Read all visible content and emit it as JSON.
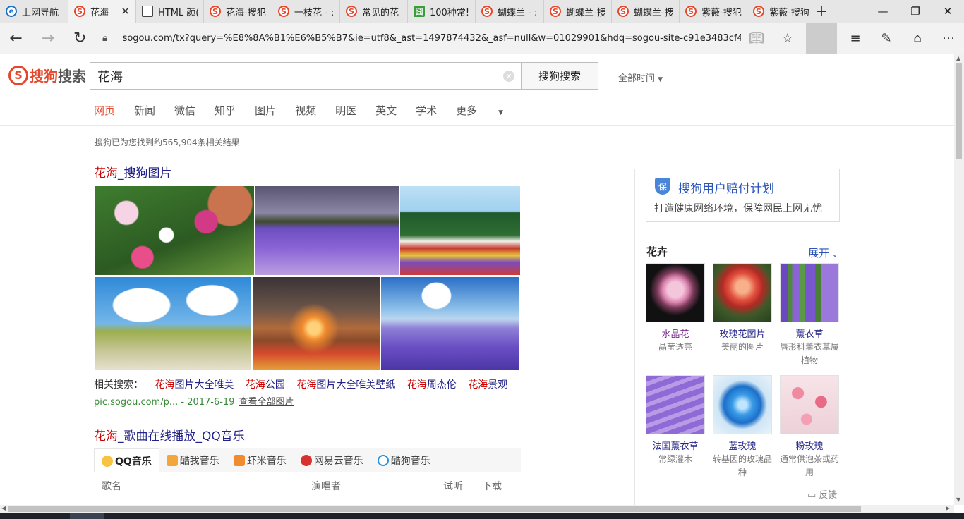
{
  "browser": {
    "tabs": [
      {
        "label": "上网导航",
        "icon": "ie-icon",
        "active": false
      },
      {
        "label": "花海",
        "icon": "sogou-icon",
        "active": true
      },
      {
        "label": "HTML 颜(",
        "icon": "doc-icon",
        "active": false
      },
      {
        "label": "花海-搜犯",
        "icon": "sogou-icon",
        "active": false
      },
      {
        "label": "一枝花 - :",
        "icon": "sogou-icon",
        "active": false
      },
      {
        "label": "常见的花",
        "icon": "sogou-icon",
        "active": false
      },
      {
        "label": "100种常!",
        "icon": "green-icon",
        "active": false
      },
      {
        "label": "蝴蝶兰 - :",
        "icon": "sogou-icon",
        "active": false
      },
      {
        "label": "蝴蝶兰-捜",
        "icon": "sogou-icon",
        "active": false
      },
      {
        "label": "蝴蝶兰-捜",
        "icon": "sogou-icon",
        "active": false
      },
      {
        "label": "紫薇-搜犯",
        "icon": "sogou-icon",
        "active": false
      },
      {
        "label": "紫薇-搜狗",
        "icon": "sogou-icon",
        "active": false
      }
    ],
    "url": "sogou.com/tx?query=%E8%8A%B1%E6%B5%B7&ie=utf8&_ast=1497874432&_asf=null&w=01029901&hdq=sogou-site-c91e3483cf4f9005-1002&duppid=1&"
  },
  "header": {
    "logo_letter": "S",
    "logo_text_1": "搜狗",
    "logo_text_2": "搜索",
    "query": "花海",
    "search_button": "搜狗搜索",
    "time_filter": "全部时间"
  },
  "verticals": [
    "网页",
    "新闻",
    "微信",
    "知乎",
    "图片",
    "视频",
    "明医",
    "英文",
    "学术",
    "更多"
  ],
  "result_count": "搜狗已为您找到约565,904条相关结果",
  "result1": {
    "title_em": "花海",
    "title_rest": "_搜狗图片",
    "related_label": "相关搜索：",
    "related": [
      {
        "em": "花海",
        "rest": "图片大全唯美"
      },
      {
        "em": "花海",
        "rest": "公园"
      },
      {
        "em": "花海",
        "rest": "图片大全唯美壁纸"
      },
      {
        "em": "花海",
        "rest": "周杰伦"
      },
      {
        "em": "花海",
        "rest": "景观"
      }
    ],
    "cite": "pic.sogou.com/p... - 2017-6-19",
    "view_all": "查看全部图片"
  },
  "result2": {
    "title_em": "花海",
    "title_rest": "_歌曲在线播放_QQ音乐",
    "music_tabs": [
      "QQ音乐",
      "酷我音乐",
      "虾米音乐",
      "网易云音乐",
      "酷狗音乐"
    ],
    "columns": [
      "歌名",
      "演唱者",
      "试听",
      "下载"
    ]
  },
  "sidebar": {
    "promo_badge": "保",
    "promo_title": "搜狗用户赔付计划",
    "promo_sub": "打造健康网络环境，保障网民上网无忧",
    "section_title": "花卉",
    "expand": "展开",
    "cards": [
      {
        "name": "水晶花",
        "desc": "晶莹透亮"
      },
      {
        "name": "玫瑰花图片",
        "desc": "美丽的图片"
      },
      {
        "name": "薰衣草",
        "desc": "唇形科薰衣草属植物"
      },
      {
        "name": "法国薰衣草",
        "desc": "常绿灌木"
      },
      {
        "name": "蓝玫瑰",
        "desc": "转基因的玫瑰品种"
      },
      {
        "name": "粉玫瑰",
        "desc": "通常供泡茶或药用"
      }
    ],
    "feedback": "反馈"
  },
  "colors": {
    "accent": "#e5472b",
    "link": "#222288",
    "highlight": "#cc0000",
    "cite": "#3a8a3a"
  }
}
